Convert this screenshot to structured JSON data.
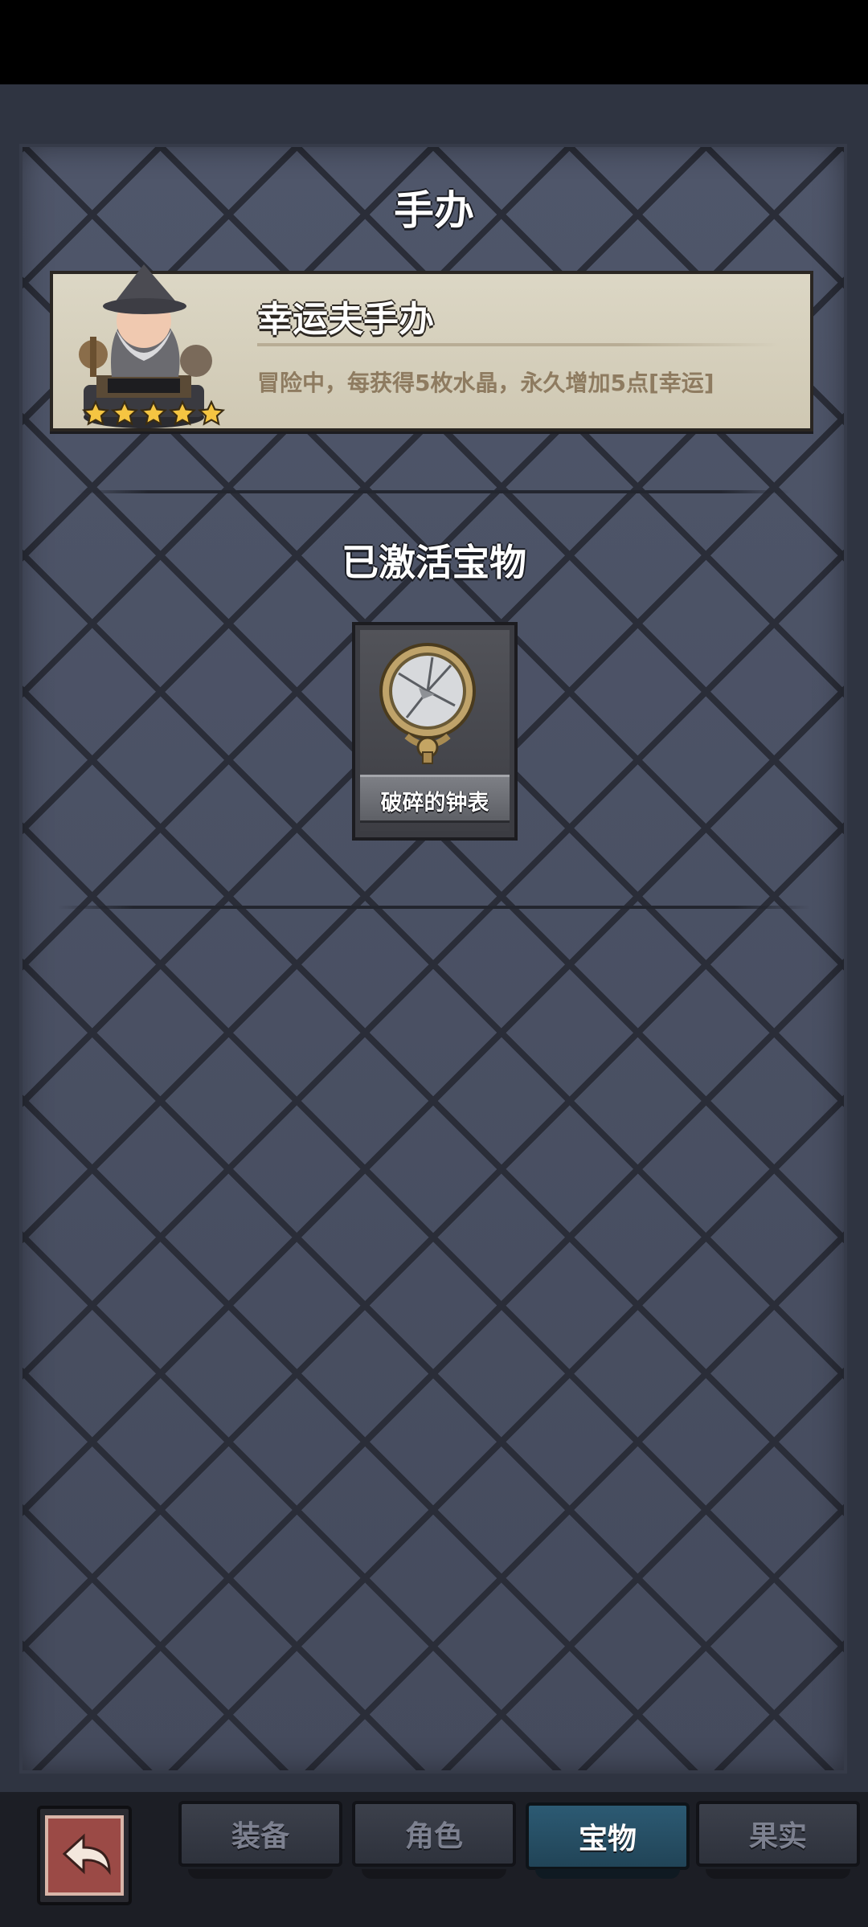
{
  "figure_section": {
    "title": "手办",
    "card": {
      "name": "幸运夫手办",
      "description": "冒险中，每获得5枚水晶，永久增加5点[幸运]",
      "stars": 5
    }
  },
  "treasure_section": {
    "title": "已激活宝物",
    "items": [
      {
        "name": "破碎的钟表",
        "icon": "broken-pocket-watch-icon"
      }
    ]
  },
  "bottom_nav": {
    "back_icon": "back-arrow-icon",
    "tabs": [
      {
        "label": "装备",
        "active": false
      },
      {
        "label": "角色",
        "active": false
      },
      {
        "label": "宝物",
        "active": true
      },
      {
        "label": "果实",
        "active": false
      }
    ]
  },
  "colors": {
    "active_tab": "#2c5a73",
    "star": "#f5c542",
    "card_bg": "#dcd7c5",
    "description_text": "#8e7b60"
  }
}
